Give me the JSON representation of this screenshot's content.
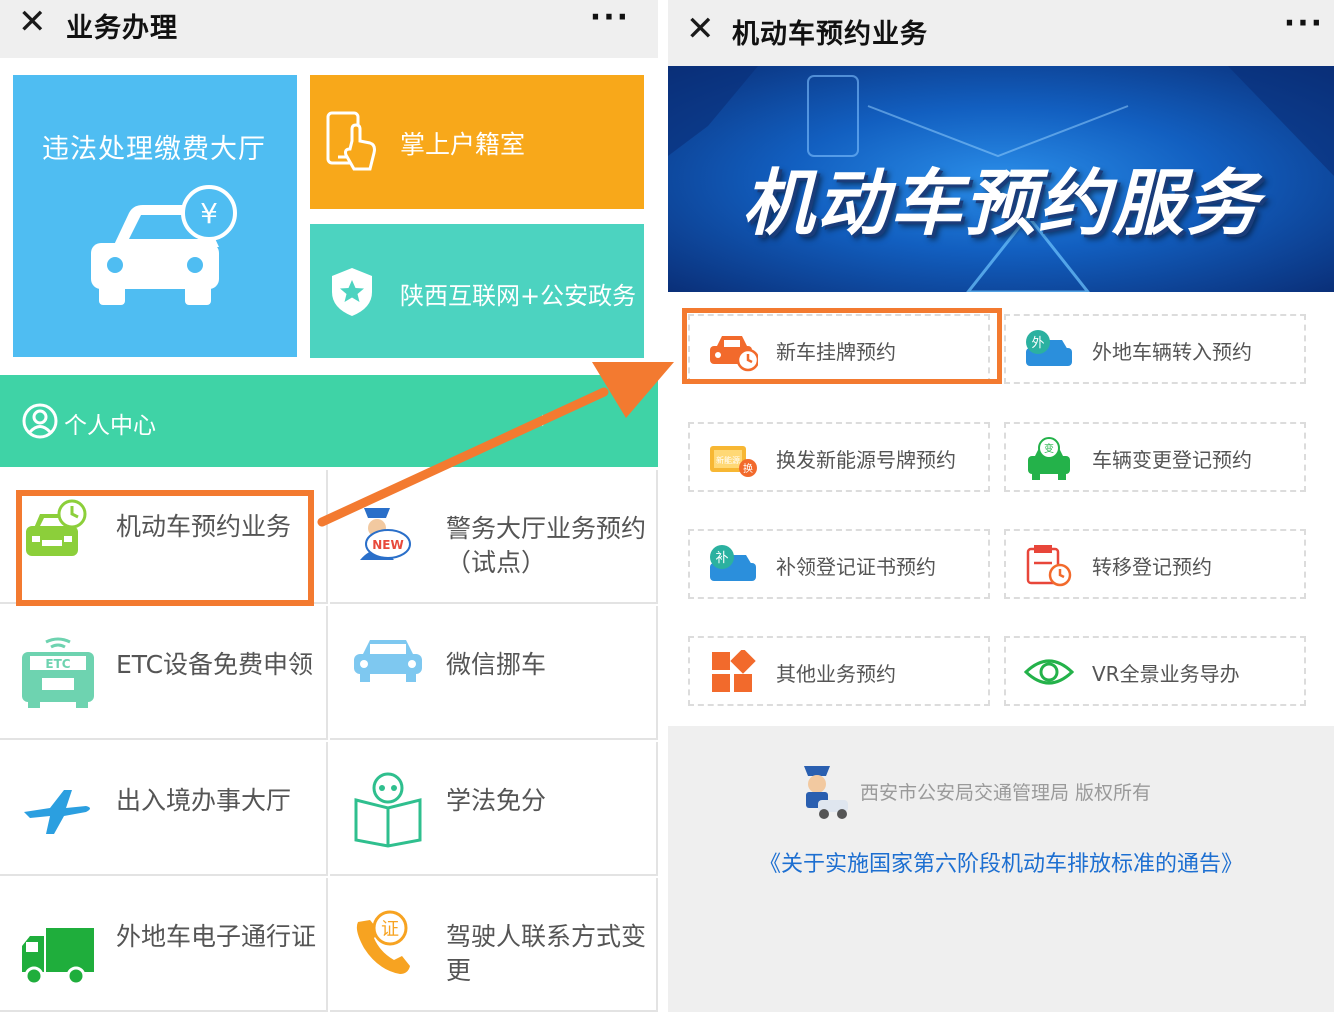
{
  "left": {
    "topbar": {
      "close_icon": "close-icon",
      "title": "业务办理",
      "more_icon": "more-dots-icon"
    },
    "tiles": {
      "violation": {
        "label": "违法处理缴费大厅",
        "icon": "car-yen-icon",
        "color": "#4fbdf2"
      },
      "household": {
        "label": "掌上户籍室",
        "icon": "phone-touch-icon",
        "color": "#f8a81a"
      },
      "internet_police": {
        "label": "陕西互联网+公安政务",
        "icon": "shield-star-icon",
        "color": "#4cd3c0"
      }
    },
    "personal_center": {
      "label": "个人中心",
      "icon": "user-circle-icon",
      "chevron": "›",
      "color": "#3fd3a6"
    },
    "grid": [
      {
        "label": "机动车预约业务",
        "icon": "car-clock-icon"
      },
      {
        "label": "警务大厅业务预约（试点）",
        "icon": "police-new-icon"
      },
      {
        "label": "ETC设备免费申领",
        "icon": "etc-car-icon"
      },
      {
        "label": "微信挪车",
        "icon": "car-front-icon"
      },
      {
        "label": "出入境办事大厅",
        "icon": "airplane-icon"
      },
      {
        "label": "学法免分",
        "icon": "book-icon"
      },
      {
        "label": "外地车电子通行证",
        "icon": "truck-icon"
      },
      {
        "label": "驾驶人联系方式变更",
        "icon": "phone-cert-icon"
      }
    ]
  },
  "right": {
    "topbar": {
      "close_icon": "close-icon",
      "title": "机动车预约业务",
      "more_icon": "more-dots-icon"
    },
    "banner": {
      "text": "机动车预约服务"
    },
    "services": [
      {
        "label": "新车挂牌预约",
        "icon": "new-car-clock-icon"
      },
      {
        "label": "外地车辆转入预约",
        "icon": "outside-car-icon"
      },
      {
        "label": "换发新能源号牌预约",
        "icon": "new-energy-plate-icon"
      },
      {
        "label": "车辆变更登记预约",
        "icon": "car-change-icon"
      },
      {
        "label": "补领登记证书预约",
        "icon": "reissue-car-icon"
      },
      {
        "label": "转移登记预约",
        "icon": "transfer-calendar-icon"
      },
      {
        "label": "其他业务预约",
        "icon": "grid-blocks-icon"
      },
      {
        "label": "VR全景业务导办",
        "icon": "eye-icon"
      }
    ],
    "footer": {
      "copyright": "西安市公安局交通管理局 版权所有",
      "notice": "《关于实施国家第六阶段机动车排放标准的通告》",
      "mascot_icon": "police-mascot-icon"
    }
  },
  "annotation": {
    "highlight_color": "#f37a30",
    "arrow_icon": "arrow-right-icon"
  }
}
